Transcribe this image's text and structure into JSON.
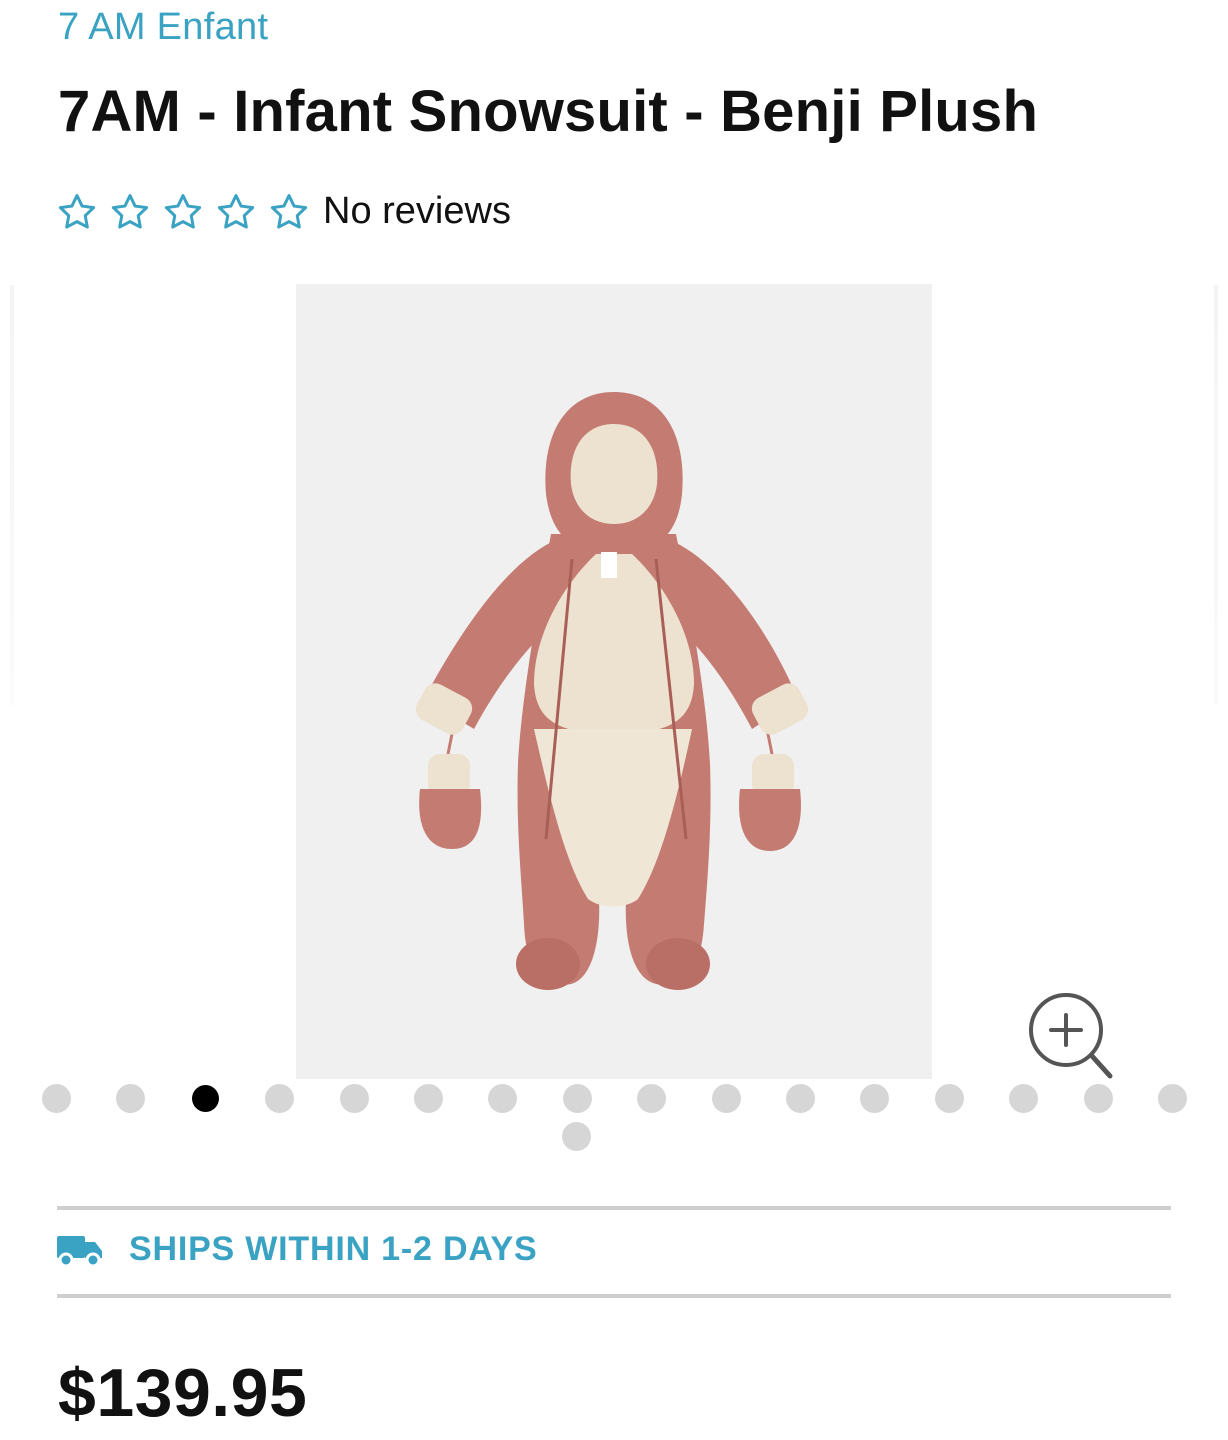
{
  "product": {
    "brand": "7 AM Enfant",
    "title": "7AM - Infant Snowsuit - Benji Plush",
    "rating": {
      "stars_filled": 0,
      "stars_total": 5,
      "reviews_label": "No reviews"
    },
    "image_alt": "7AM Infant Snowsuit Benji Plush in dusty pink with cream plush lining and mittens",
    "price": "$139.95"
  },
  "gallery": {
    "slide_count": 17,
    "active_index": 2
  },
  "shipping": {
    "label": "SHIPS WITHIN 1-2 DAYS"
  },
  "colors": {
    "accent": "#3aa2c2",
    "suit": "#c47c72",
    "lining": "#ece2cf",
    "image_bg": "#f0f0f0",
    "dot_inactive": "#d6d6d6",
    "dot_active": "#000000"
  },
  "icons": {
    "star": "star-outline-icon",
    "zoom": "zoom-in-icon",
    "shipping": "truck-icon"
  }
}
